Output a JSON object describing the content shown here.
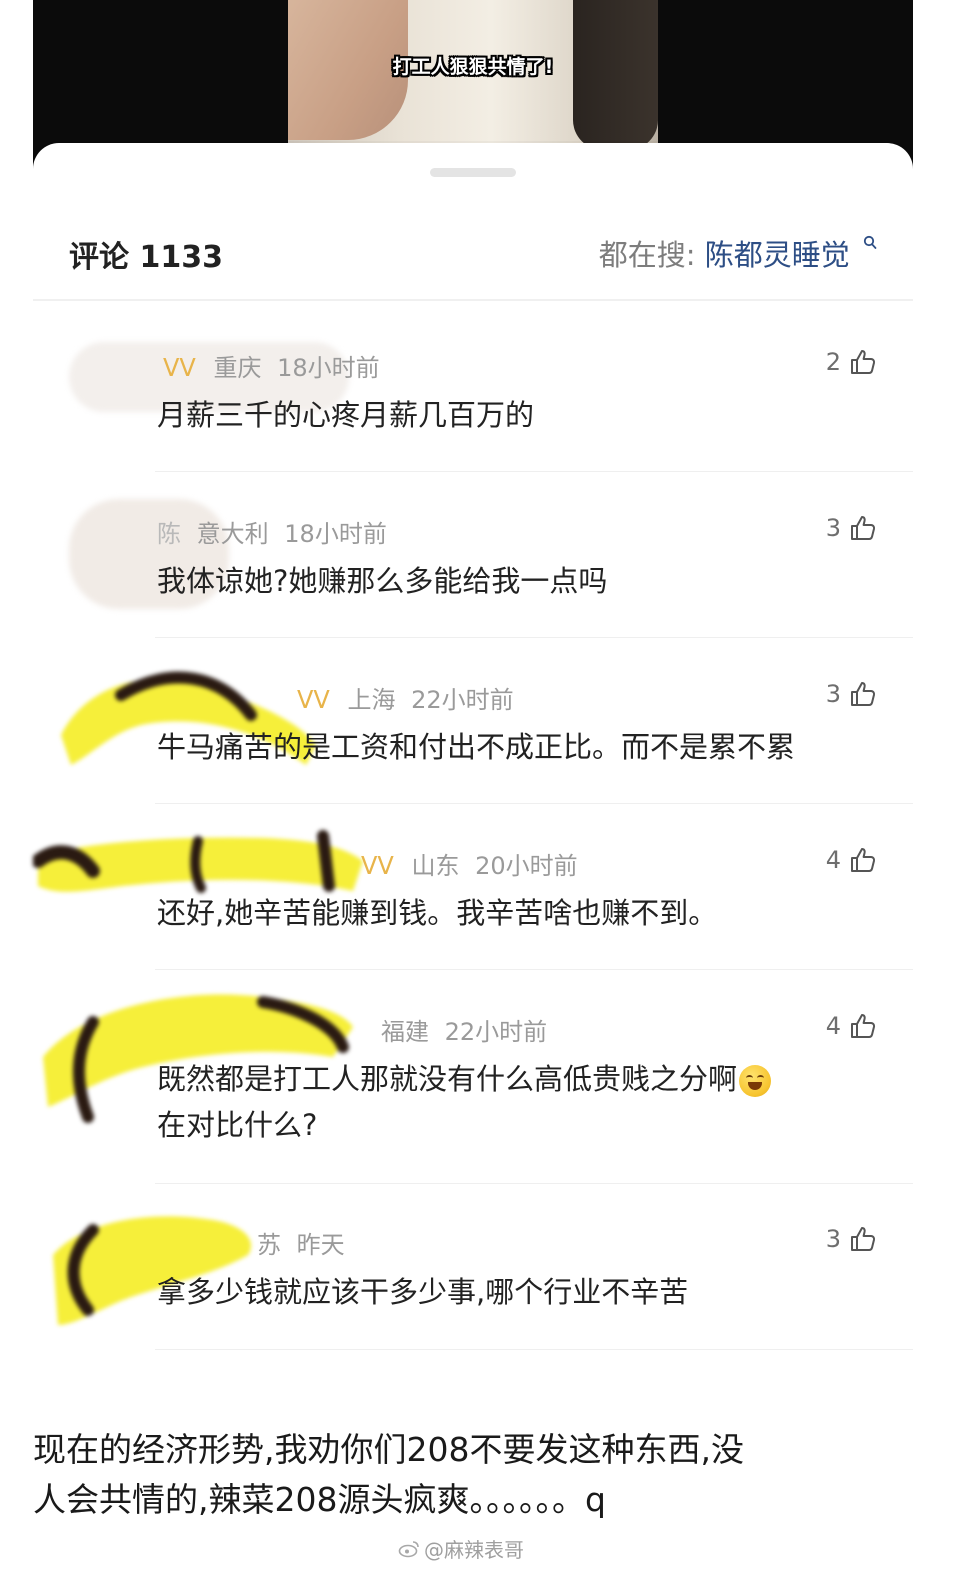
{
  "video": {
    "caption": "打工人狠狠共情了!"
  },
  "sheet": {
    "comment_count": "评论 1133",
    "hot_search_label": "都在搜:",
    "hot_search_term": "陈都灵睡觉"
  },
  "comments": [
    {
      "user": "",
      "region": "重庆",
      "time": "18小时前",
      "likes": "2",
      "text": "月薪三千的心疼月薪几百万的"
    },
    {
      "user": "陈",
      "region": "意大利",
      "time": "18小时前",
      "likes": "3",
      "text": "我体谅她?她赚那么多能给我一点吗"
    },
    {
      "user": "",
      "region": "上海",
      "time": "22小时前",
      "likes": "3",
      "text": "牛马痛苦的是工资和付出不成正比。而不是累不累"
    },
    {
      "user": "",
      "region": "山东",
      "time": "20小时前",
      "likes": "4",
      "text": "还好,她辛苦能赚到钱。我辛苦啥也赚不到。"
    },
    {
      "user": "",
      "region": "福建",
      "time": "22小时前",
      "likes": "4",
      "text_line1": "既然都是打工人那就没有什么高低贵贱之分啊",
      "text_line2": "在对比什么?"
    },
    {
      "user": "",
      "region": "苏",
      "time": "昨天",
      "likes": "3",
      "text": "拿多少钱就应该干多少事,哪个行业不辛苦"
    }
  ],
  "post": {
    "caption_line1": "现在的经济形势,我劝你们208不要发这种东西,没",
    "caption_line2": "人会共情的,辣菜208源头疯爽。。。。。。q",
    "watermark": "@麻辣表哥"
  },
  "colors": {
    "accent_link": "#2d4e85",
    "vip_badge": "#e8b44a",
    "redaction_yellow": "#f6ef3a"
  },
  "icons": [
    "search-icon",
    "thumbs-up-icon",
    "vip-badge-icon",
    "laughing-tears-emoji",
    "weibo-icon"
  ]
}
